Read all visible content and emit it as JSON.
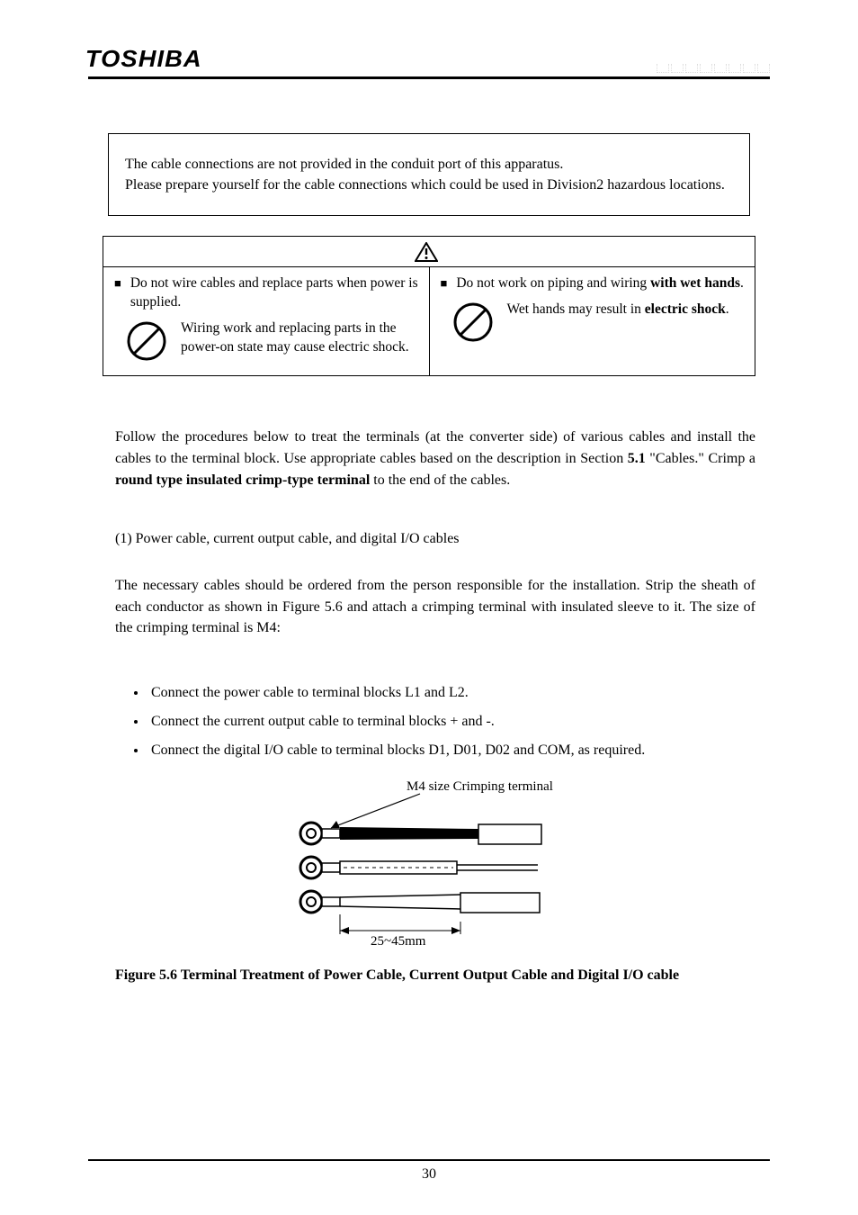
{
  "header": {
    "logo": "TOSHIBA"
  },
  "note_box": {
    "line1": "The cable connections are not provided in the conduit port of this apparatus.",
    "line2": "Please prepare yourself for the cable connections which could be used in Division2 hazardous locations."
  },
  "caution": {
    "heading": "CAUTION",
    "left": {
      "bullet": "Do not wire cables and replace parts when power is supplied.",
      "sub": "Wiring work and replacing parts in the power-on state may cause electric shock."
    },
    "right": {
      "bullet_pre": "Do not work on piping and wiring ",
      "bullet_bold": "with wet hands",
      "bullet_post": ".",
      "sub_pre": "Wet hands may result in ",
      "sub_bold": "electric shock",
      "sub_post": "."
    }
  },
  "body": {
    "p1_pre": "Follow the procedures below to treat the terminals (at the converter side) of various cables and install the cables to the terminal block. Use appropriate cables based on the description in Section ",
    "p1_b1": "5.1",
    "p1_mid": " \"Cables.\" Crimp a ",
    "p1_b2": "round type insulated crimp-type terminal",
    "p1_post": " to the end of the cables.",
    "p2": "(1)   Power cable, current output cable, and digital I/O cables",
    "p3": "The necessary cables should be ordered from the person responsible for the installation. Strip the sheath of each conductor as shown in Figure 5.6 and attach a crimping terminal with insulated sleeve to it. The size of the crimping terminal is M4:",
    "bullets": [
      "Connect the power cable to terminal blocks L1 and L2.",
      "Connect the current output cable to terminal blocks + and -.",
      "Connect the digital I/O cable to terminal blocks D1, D01, D02 and COM, as required."
    ]
  },
  "figure": {
    "label_top": "M4 size Crimping terminal",
    "label_bottom": "25~45mm",
    "caption": "Figure 5.6    Terminal Treatment of Power Cable, Current Output Cable and Digital I/O cable"
  },
  "footer": {
    "page": "30"
  }
}
